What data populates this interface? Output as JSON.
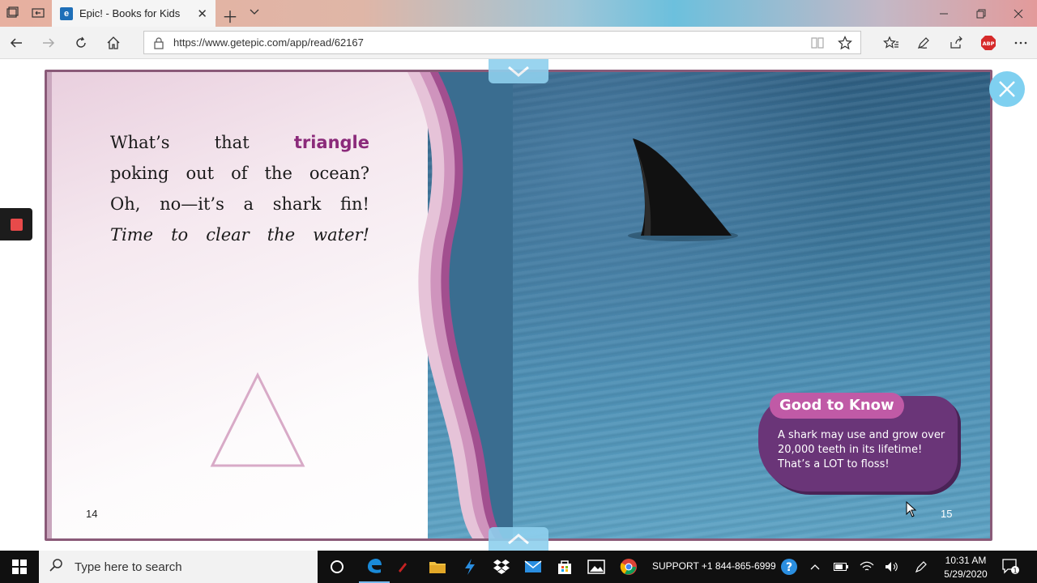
{
  "browser": {
    "tab_title": "Epic! - Books for Kids",
    "tab_favicon_letter": "e",
    "url": "https://www.getepic.com/app/read/62167",
    "adblock_label": "ABP"
  },
  "book": {
    "story_lines": [
      {
        "parts": [
          {
            "text": "What’s that ",
            "style": "normal"
          },
          {
            "text": "triangle",
            "style": "highlight"
          }
        ]
      },
      {
        "parts": [
          {
            "text": "poking out of the ocean?",
            "style": "normal"
          }
        ]
      },
      {
        "parts": [
          {
            "text": "Oh, no—it’s a shark fin!",
            "style": "normal"
          }
        ]
      },
      {
        "parts": [
          {
            "text": "Time to clear the water!",
            "style": "italic"
          }
        ]
      }
    ],
    "left_page_number": "14",
    "right_page_number": "15",
    "good_to_know": {
      "title": "Good to Know",
      "text": "A shark may use and grow over 20,000 teeth in its lifetime!  That’s a LOT to floss!"
    },
    "colors": {
      "accent_purple": "#8b2a7a",
      "callout_bg": "#6a3578",
      "callout_title_bg": "#c05aa6",
      "reader_nav": "#8fd0ee"
    }
  },
  "taskbar": {
    "search_placeholder": "Type here to search",
    "support_text": "SUPPORT +1 844-865-6999",
    "time": "10:31 AM",
    "date": "5/29/2020",
    "notification_count": "1"
  }
}
